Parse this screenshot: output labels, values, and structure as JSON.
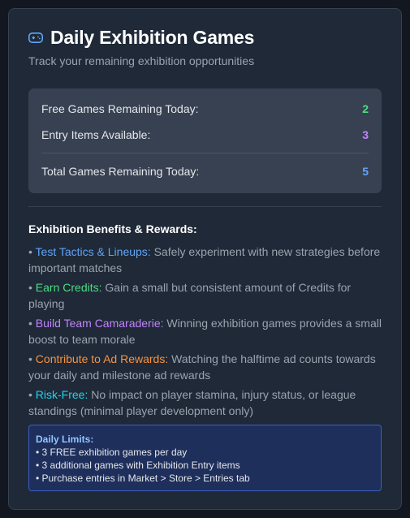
{
  "header": {
    "icon": "gamepad-icon",
    "title": "Daily Exhibition Games",
    "subtitle": "Track your remaining exhibition opportunities"
  },
  "stats": {
    "free": {
      "label": "Free Games Remaining Today:",
      "value": "2",
      "color": "#4ade80"
    },
    "entry": {
      "label": "Entry Items Available:",
      "value": "3",
      "color": "#c084fc"
    },
    "total": {
      "label": "Total Games Remaining Today:",
      "value": "5",
      "color": "#60a5fa"
    }
  },
  "benefits": {
    "title": "Exhibition Benefits & Rewards:",
    "items": [
      {
        "name": "Test Tactics & Lineups:",
        "text": " Safely experiment with new strategies before important matches",
        "color": "#60a5fa"
      },
      {
        "name": "Earn Credits:",
        "text": " Gain a small but consistent amount of Credits for playing",
        "color": "#4ade80"
      },
      {
        "name": "Build Team Camaraderie:",
        "text": " Winning exhibition games provides a small boost to team morale",
        "color": "#c084fc"
      },
      {
        "name": "Contribute to Ad Rewards:",
        "text": " Watching the halftime ad counts towards your daily and milestone ad rewards",
        "color": "#fb923c"
      },
      {
        "name": "Risk-Free:",
        "text": " No impact on player stamina, injury status, or league standings (minimal player development only)",
        "color": "#22d3ee"
      }
    ]
  },
  "limits": {
    "title": "Daily Limits:",
    "lines": [
      "• 3 FREE exhibition games per day",
      "• 3 additional games with Exhibition Entry items",
      "• Purchase entries in Market > Store > Entries tab"
    ]
  }
}
